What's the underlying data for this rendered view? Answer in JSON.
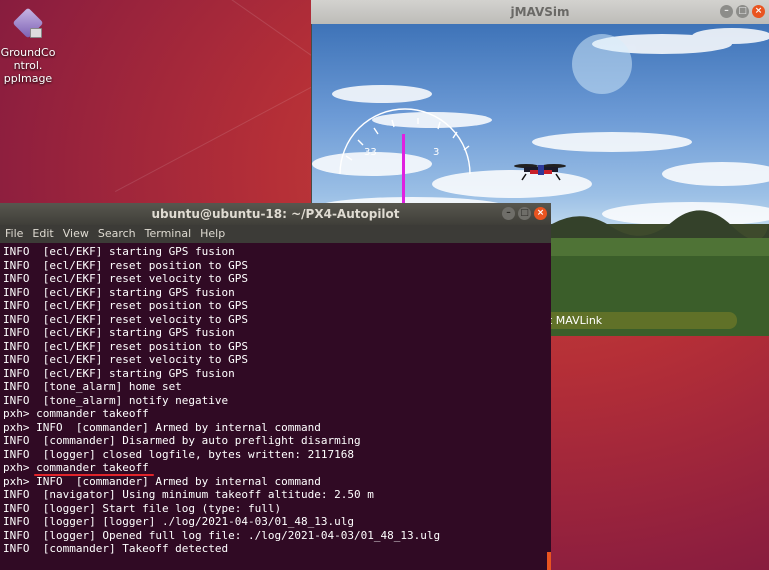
{
  "desktop": {
    "icon_label": "GroundControl.AppImage",
    "icon_label_lines": [
      "GroundCo",
      "ntrol.",
      "ppImage"
    ]
  },
  "sim": {
    "title": "jMAVSim",
    "compass_labels": [
      "33",
      "3"
    ],
    "status_text": "t MAVLink",
    "accent_color": "#e020e0"
  },
  "terminal": {
    "title": "ubuntu@ubuntu-18: ~/PX4-Autopilot",
    "menu": [
      "File",
      "Edit",
      "View",
      "Search",
      "Terminal",
      "Help"
    ],
    "lines": [
      "INFO  [ecl/EKF] starting GPS fusion",
      "INFO  [ecl/EKF] reset position to GPS",
      "INFO  [ecl/EKF] reset velocity to GPS",
      "INFO  [ecl/EKF] starting GPS fusion",
      "INFO  [ecl/EKF] reset position to GPS",
      "INFO  [ecl/EKF] reset velocity to GPS",
      "INFO  [ecl/EKF] starting GPS fusion",
      "INFO  [ecl/EKF] reset position to GPS",
      "INFO  [ecl/EKF] reset velocity to GPS",
      "INFO  [ecl/EKF] starting GPS fusion",
      "INFO  [tone_alarm] home set",
      "INFO  [tone_alarm] notify negative",
      "pxh> commander takeoff",
      "pxh> INFO  [commander] Armed by internal command",
      "INFO  [commander] Disarmed by auto preflight disarming",
      "INFO  [logger] closed logfile, bytes written: 2117168",
      "pxh> commander takeoff",
      "pxh> INFO  [commander] Armed by internal command",
      "INFO  [navigator] Using minimum takeoff altitude: 2.50 m",
      "INFO  [logger] Start file log (type: full)",
      "INFO  [logger] [logger] ./log/2021-04-03/01_48_13.ulg",
      "INFO  [logger] Opened full log file: ./log/2021-04-03/01_48_13.ulg",
      "INFO  [commander] Takeoff detected"
    ]
  },
  "colors": {
    "ubuntu_orange": "#e95420",
    "terminal_bg": "#300a24",
    "highlight_underline": "#e0242a"
  }
}
